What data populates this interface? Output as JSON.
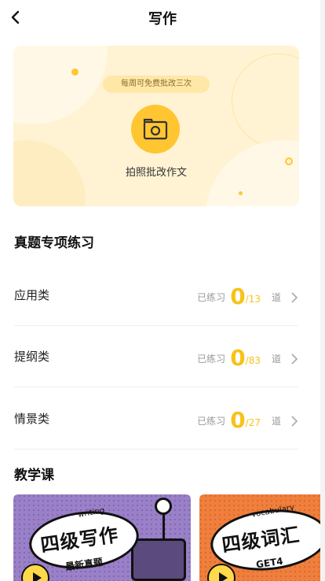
{
  "header": {
    "title": "写作"
  },
  "hero": {
    "free_notice": "每周可免费批改三次",
    "action_label": "拍照批改作文"
  },
  "practice": {
    "section_title": "真题专项练习",
    "items": [
      {
        "label": "应用类",
        "practiced_label": "已练习",
        "done": "0",
        "total": "/13",
        "unit": "道"
      },
      {
        "label": "提纲类",
        "practiced_label": "已练习",
        "done": "0",
        "total": "/83",
        "unit": "道"
      },
      {
        "label": "情景类",
        "practiced_label": "已练习",
        "done": "0",
        "total": "/27",
        "unit": "道"
      }
    ]
  },
  "courses": {
    "section_title": "教学课",
    "cards": [
      {
        "tag": "writing",
        "title": "四级写作",
        "subtitle": "最新真题"
      },
      {
        "tag": "vocabulary",
        "title": "四级词汇",
        "subtitle": "GET4"
      }
    ]
  },
  "colors": {
    "accent": "#ffc631",
    "hero_bg": "#fff3d3",
    "card1": "#9a80c8",
    "card2": "#f07f3d"
  }
}
